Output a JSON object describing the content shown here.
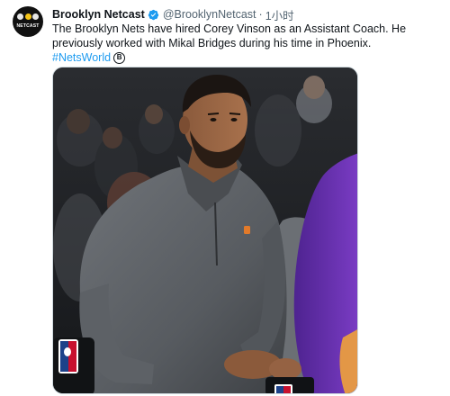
{
  "tweet": {
    "display_name": "Brooklyn Netcast",
    "verified": true,
    "handle": "@BrooklynNetcast",
    "separator": "·",
    "time": "1小时",
    "text_line1": "The Brooklyn Nets have hired Corey Vinson as an Assistant Coach. He",
    "text_line2": "previously worked with Mikal Bridges during his time in Phoenix.",
    "hashtag": "#NetsWorld",
    "hashtag_emoji": "B"
  },
  "avatar": {
    "label": "NETCAST",
    "icon": "netcast-logo"
  },
  "media": {
    "alt_description_icon": "photo",
    "jersey_logo_icon": "nba-logo-icon"
  },
  "colors": {
    "link": "#1d9bf0",
    "verified": "#1d9bf0",
    "secondary_text": "#536471",
    "primary_text": "#0f1419",
    "purple_jersey": "#6a2fb0"
  }
}
